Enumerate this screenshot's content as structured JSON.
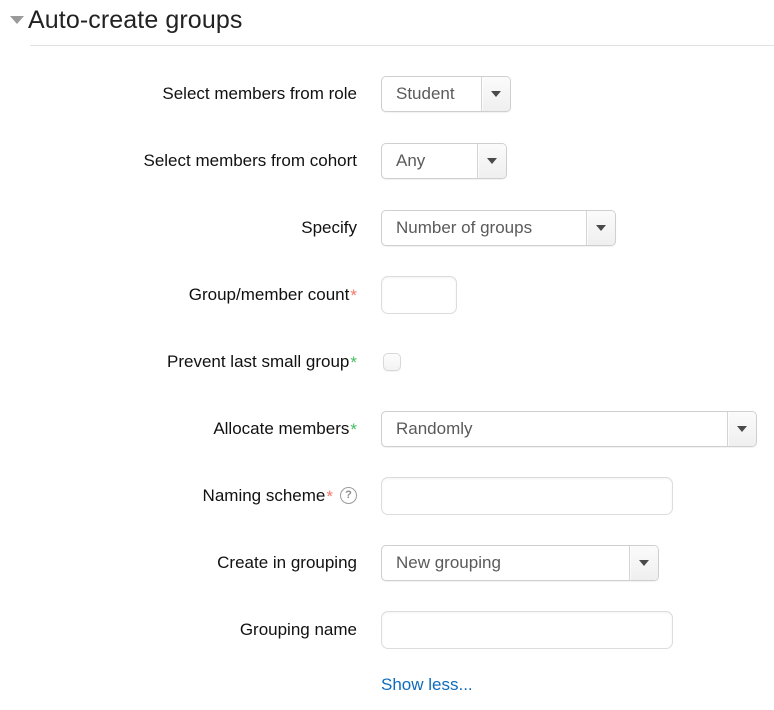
{
  "section": {
    "title": "Auto-create groups",
    "collapse_icon": "caret-down-icon",
    "expanded": true
  },
  "form": {
    "rows": [
      {
        "label": "Select members from role",
        "required_marker": "",
        "advanced_marker": "",
        "control": "select",
        "value": "Student"
      },
      {
        "label": "Select members from cohort",
        "required_marker": "",
        "advanced_marker": "",
        "control": "select",
        "value": "Any"
      },
      {
        "label": "Specify",
        "required_marker": "",
        "advanced_marker": "",
        "control": "select",
        "value": "Number of groups"
      },
      {
        "label": "Group/member count",
        "required_marker": "*",
        "advanced_marker": "",
        "control": "text",
        "value": "",
        "placeholder": ""
      },
      {
        "label": "Prevent last small group",
        "required_marker": "",
        "advanced_marker": "*",
        "control": "checkbox",
        "checked": false
      },
      {
        "label": "Allocate members",
        "required_marker": "",
        "advanced_marker": "*",
        "control": "select",
        "value": "Randomly"
      },
      {
        "label": "Naming scheme",
        "required_marker": "*",
        "advanced_marker": "",
        "help_icon": "help-question-icon",
        "help_glyph": "?",
        "control": "text",
        "value": "",
        "placeholder": ""
      },
      {
        "label": "Create in grouping",
        "required_marker": "",
        "advanced_marker": "",
        "control": "select",
        "value": "New grouping"
      },
      {
        "label": "Grouping name",
        "required_marker": "",
        "advanced_marker": "",
        "control": "text",
        "value": "",
        "placeholder": ""
      }
    ]
  },
  "footer": {
    "show_less_label": "Show less..."
  },
  "colors": {
    "required_star": "#f4766b",
    "advanced_star": "#3fbf5f",
    "link": "#0f6cbd",
    "label_text": "#111111",
    "select_text": "#5a5a5a",
    "background": "#ffffff"
  }
}
